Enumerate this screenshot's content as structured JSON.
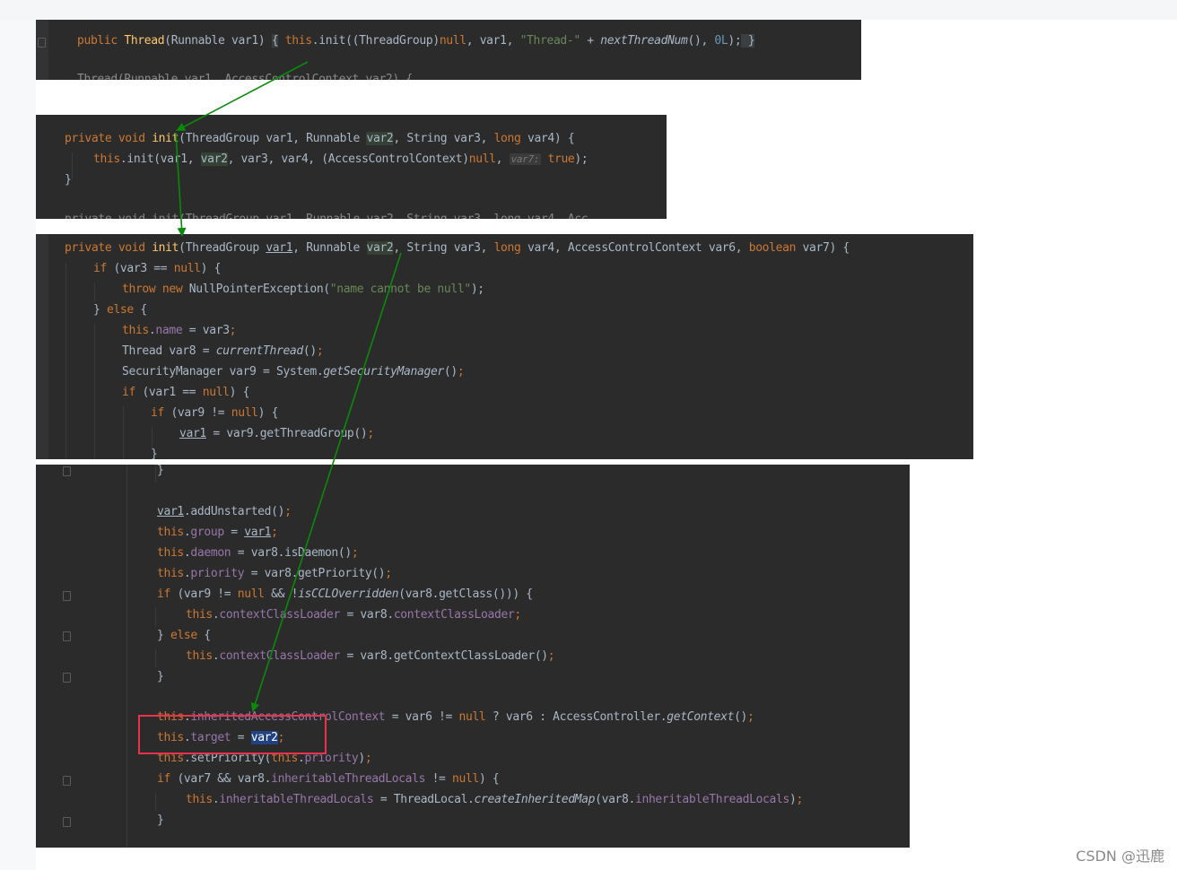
{
  "panel1": {
    "line1": {
      "t1": "public ",
      "t2": "Thread",
      "t3": "(Runnable var1) ",
      "t4": "{",
      "t5": " ",
      "t6": "this",
      "t7": ".init((ThreadGroup)",
      "t8": "null",
      "t9": ", var1, ",
      "t10": "\"Thread-\"",
      "t11": " + ",
      "t12": "nextThreadNum",
      "t13": "(), ",
      "t14": "0L",
      "t15": ");",
      "t16": " }"
    },
    "line2_partial": "Thread(Runnable var1, AccessControlContext var2) {"
  },
  "panel2": {
    "line1": {
      "t1": "private void ",
      "t2": "init",
      "t3": "(ThreadGroup var1, Runnable ",
      "t4": "var2",
      "t5": ", String var3, ",
      "t6": "long",
      "t7": " var4) {"
    },
    "line2": {
      "t1": "this",
      "t2": ".init(var1, ",
      "t3": "var2",
      "t4": ", var3, var4, (AccessControlContext)",
      "t5": "null",
      "t6": ", ",
      "hint": "var7:",
      "t7": " ",
      "t8": "true",
      "t9": ");"
    },
    "line3": "}",
    "line4_partial": "private void init(ThreadGroup var1, Runnable var2, String var3, long var4, Acc"
  },
  "panel3": {
    "line1": {
      "t1": "private void ",
      "t2": "init",
      "t3": "(ThreadGroup ",
      "t4": "var1",
      "t5": ", Runnable ",
      "t6": "var2",
      "t7": ", String var3, ",
      "t8": "long",
      "t9": " var4, AccessControlContext var6, ",
      "t10": "boolean",
      "t11": " var7) {"
    },
    "line2": {
      "t1": "if",
      "t2": " (var3 == ",
      "t3": "null",
      "t4": ") {"
    },
    "line3": {
      "t1": "throw new",
      "t2": " NullPointerException(",
      "t3": "\"name cannot be null\"",
      "t4": ");"
    },
    "line4": {
      "t1": "} ",
      "t2": "else",
      "t3": " {"
    },
    "line5": {
      "t1": "this",
      "t2": ".",
      "t3": "name",
      "t4": " = var3",
      "t5": ";"
    },
    "line6": {
      "t1": "Thread var8 = ",
      "t2": "currentThread",
      "t3": "()",
      "t4": ";"
    },
    "line7": {
      "t1": "SecurityManager var9 = System.",
      "t2": "getSecurityManager",
      "t3": "()",
      "t4": ";"
    },
    "line8": {
      "t1": "if",
      "t2": " (var1 == ",
      "t3": "null",
      "t4": ") {"
    },
    "line9": {
      "t1": "if",
      "t2": " (var9 != ",
      "t3": "null",
      "t4": ") {"
    },
    "line10": {
      "t1": "var1",
      "t2": " = var9.getThreadGroup()",
      "t3": ";"
    },
    "line11": "}"
  },
  "panel4": {
    "line1": "}",
    "line2": {
      "t1": "var1",
      "t2": ".addUnstarted()",
      "t3": ";"
    },
    "line3": {
      "t1": "this",
      "t2": ".",
      "t3": "group",
      "t4": " = ",
      "t5": "var1",
      "t6": ";"
    },
    "line4": {
      "t1": "this",
      "t2": ".",
      "t3": "daemon",
      "t4": " = var8.isDaemon()",
      "t5": ";"
    },
    "line5": {
      "t1": "this",
      "t2": ".",
      "t3": "priority",
      "t4": " = var8.getPriority()",
      "t5": ";"
    },
    "line6": {
      "t1": "if",
      "t2": " (var9 != ",
      "t3": "null",
      "t4": " && !",
      "t5": "isCCLOverridden",
      "t6": "(var8.getClass())) {"
    },
    "line7": {
      "t1": "this",
      "t2": ".",
      "t3": "contextClassLoader",
      "t4": " = var8.",
      "t5": "contextClassLoader",
      "t6": ";"
    },
    "line8": {
      "t1": "} ",
      "t2": "else",
      "t3": " {"
    },
    "line9": {
      "t1": "this",
      "t2": ".",
      "t3": "contextClassLoader",
      "t4": " = var8.getContextClassLoader()",
      "t5": ";"
    },
    "line10": "}",
    "line11": {
      "t1": "this",
      "t2": ".",
      "t3": "inheritedAccessControlContext",
      "t4": " = var6 != ",
      "t5": "null",
      "t6": " ? var6 : AccessController.",
      "t7": "getContext",
      "t8": "()",
      "t9": ";"
    },
    "line12": {
      "t1": "this",
      "t2": ".",
      "t3": "target",
      "t4": " = ",
      "t5": "var2",
      "t6": ";"
    },
    "line13": {
      "t1": "this",
      "t2": ".setPriority(",
      "t3": "this",
      "t4": ".",
      "t5": "priority",
      "t6": ")",
      "t7": ";"
    },
    "line14": {
      "t1": "if",
      "t2": " (var7 && var8.",
      "t3": "inheritableThreadLocals",
      "t4": " != ",
      "t5": "null",
      "t6": ") {"
    },
    "line15": {
      "t1": "this",
      "t2": ".",
      "t3": "inheritableThreadLocals",
      "t4": " = ThreadLocal.",
      "t5": "createInheritedMap",
      "t6": "(var8.",
      "t7": "inheritableThreadLocals",
      "t8": ")",
      "t9": ";"
    },
    "line16": "}"
  },
  "colors": {
    "editor_bg": "#2b2b2b",
    "keyword": "#cc7832",
    "method": "#ffc66d",
    "string": "#6a8759",
    "number": "#6897bb",
    "field": "#9876aa",
    "arrow": "#0a8a0a",
    "highlight_box": "#e8334a"
  },
  "watermark": "CSDN @迅鹿"
}
